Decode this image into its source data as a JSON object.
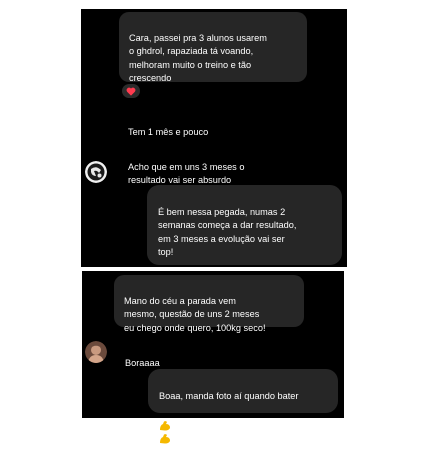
{
  "chat_top": {
    "messages": [
      {
        "text": "Cara, passei pra 3 alunos usarem\no ghdrol, rapaziada tá voando,\nmelhoram muito o treino e tão\ncrescendo",
        "side": "incoming"
      },
      {
        "text": "Tem 1 mês e pouco",
        "side": "incoming"
      },
      {
        "text": "Acho que em uns 3 meses o\nresultado vai ser absurdo",
        "side": "incoming"
      },
      {
        "text": "É bem nessa pegada,  numas 2\nsemanas começa a dar resultado,\nem 3 meses a evolução vai ser\ntop!",
        "side": "outgoing"
      }
    ],
    "reaction": {
      "icon": "heart-icon",
      "color": "#ff3b4f"
    }
  },
  "chat_bottom": {
    "messages": [
      {
        "text": "Mano do céu a parada vem\nmesmo, questão de uns 2 meses\neu chego onde quero, 100kg seco!",
        "side": "incoming"
      },
      {
        "text": "Boraaaa",
        "side": "incoming"
      },
      {
        "text": "Boaa, manda foto aí quando bater",
        "side": "outgoing"
      }
    ],
    "emoji_icons": [
      "flexed-biceps-icon",
      "flexed-biceps-icon"
    ]
  },
  "colors": {
    "panel_bg": "#000000",
    "bubble_bg": "#262626",
    "text": "#ffffff",
    "emoji": "#f5b800"
  }
}
